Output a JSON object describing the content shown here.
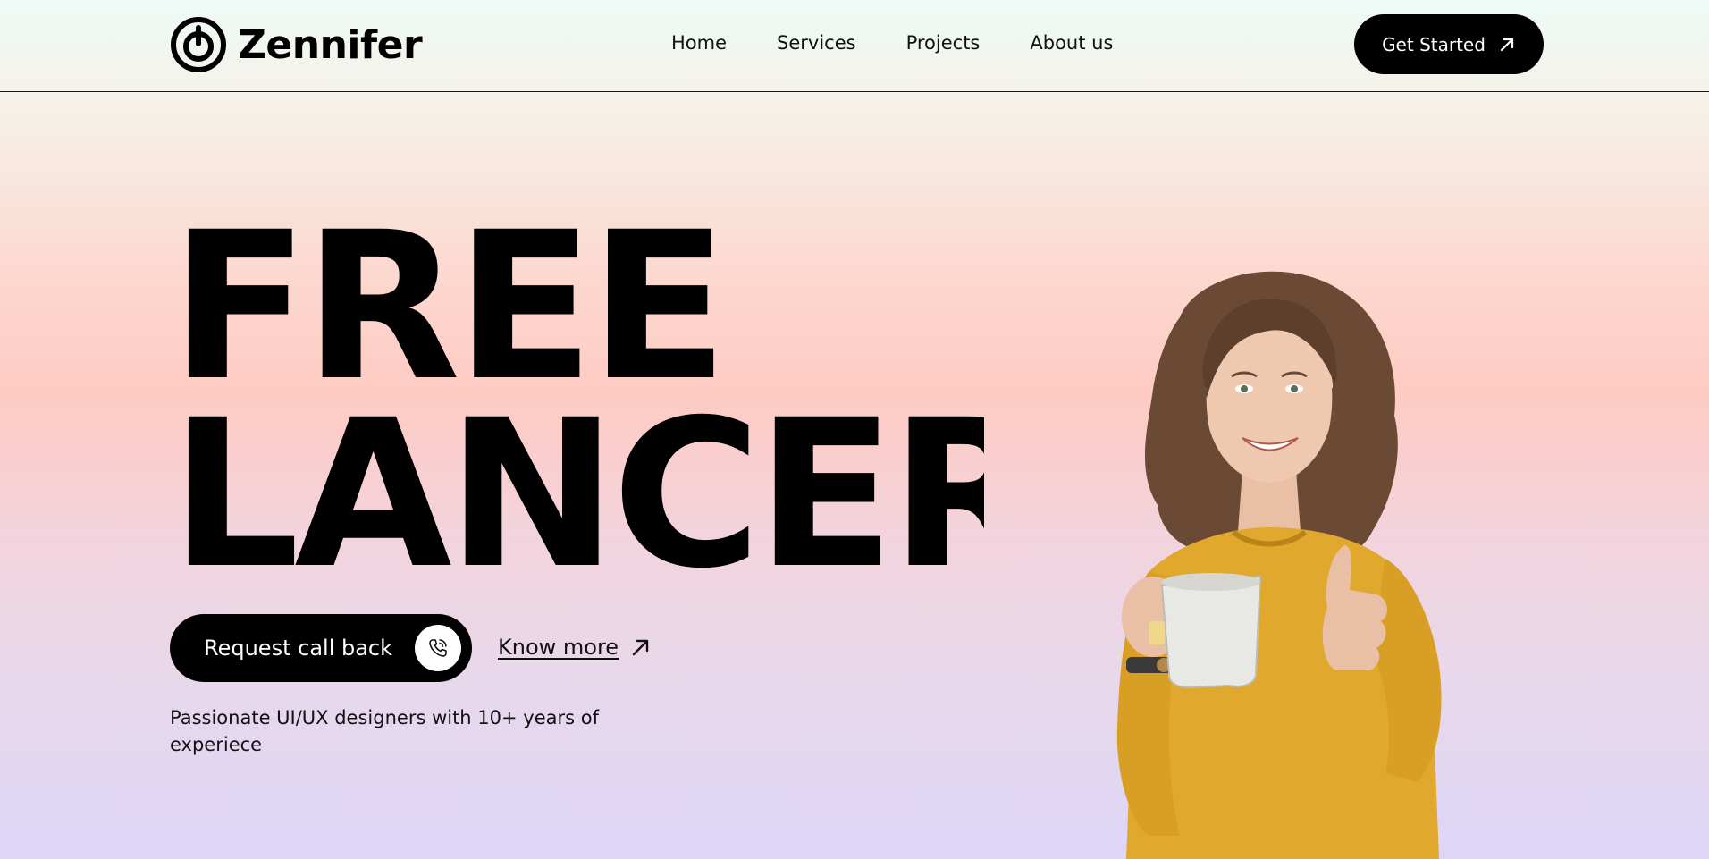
{
  "header": {
    "brand": "Zennifer",
    "nav": [
      {
        "label": "Home"
      },
      {
        "label": "Services"
      },
      {
        "label": "Projects"
      },
      {
        "label": "About us"
      }
    ],
    "cta_label": "Get Started"
  },
  "hero": {
    "title_line1": "FREE",
    "title_line2": "LANCER",
    "primary_button_label": "Request call back",
    "secondary_link_label": "Know more",
    "tagline": "Passionate UI/UX designers with 10+ years of experiece"
  },
  "icons": {
    "logo": "zennifer-logo-icon",
    "cta": "arrow-up-right-icon",
    "call": "phone-icon",
    "know_more": "arrow-up-right-icon"
  },
  "colors": {
    "primary": "#000000",
    "on_primary": "#ffffff",
    "sweater": "#e0a82c"
  }
}
